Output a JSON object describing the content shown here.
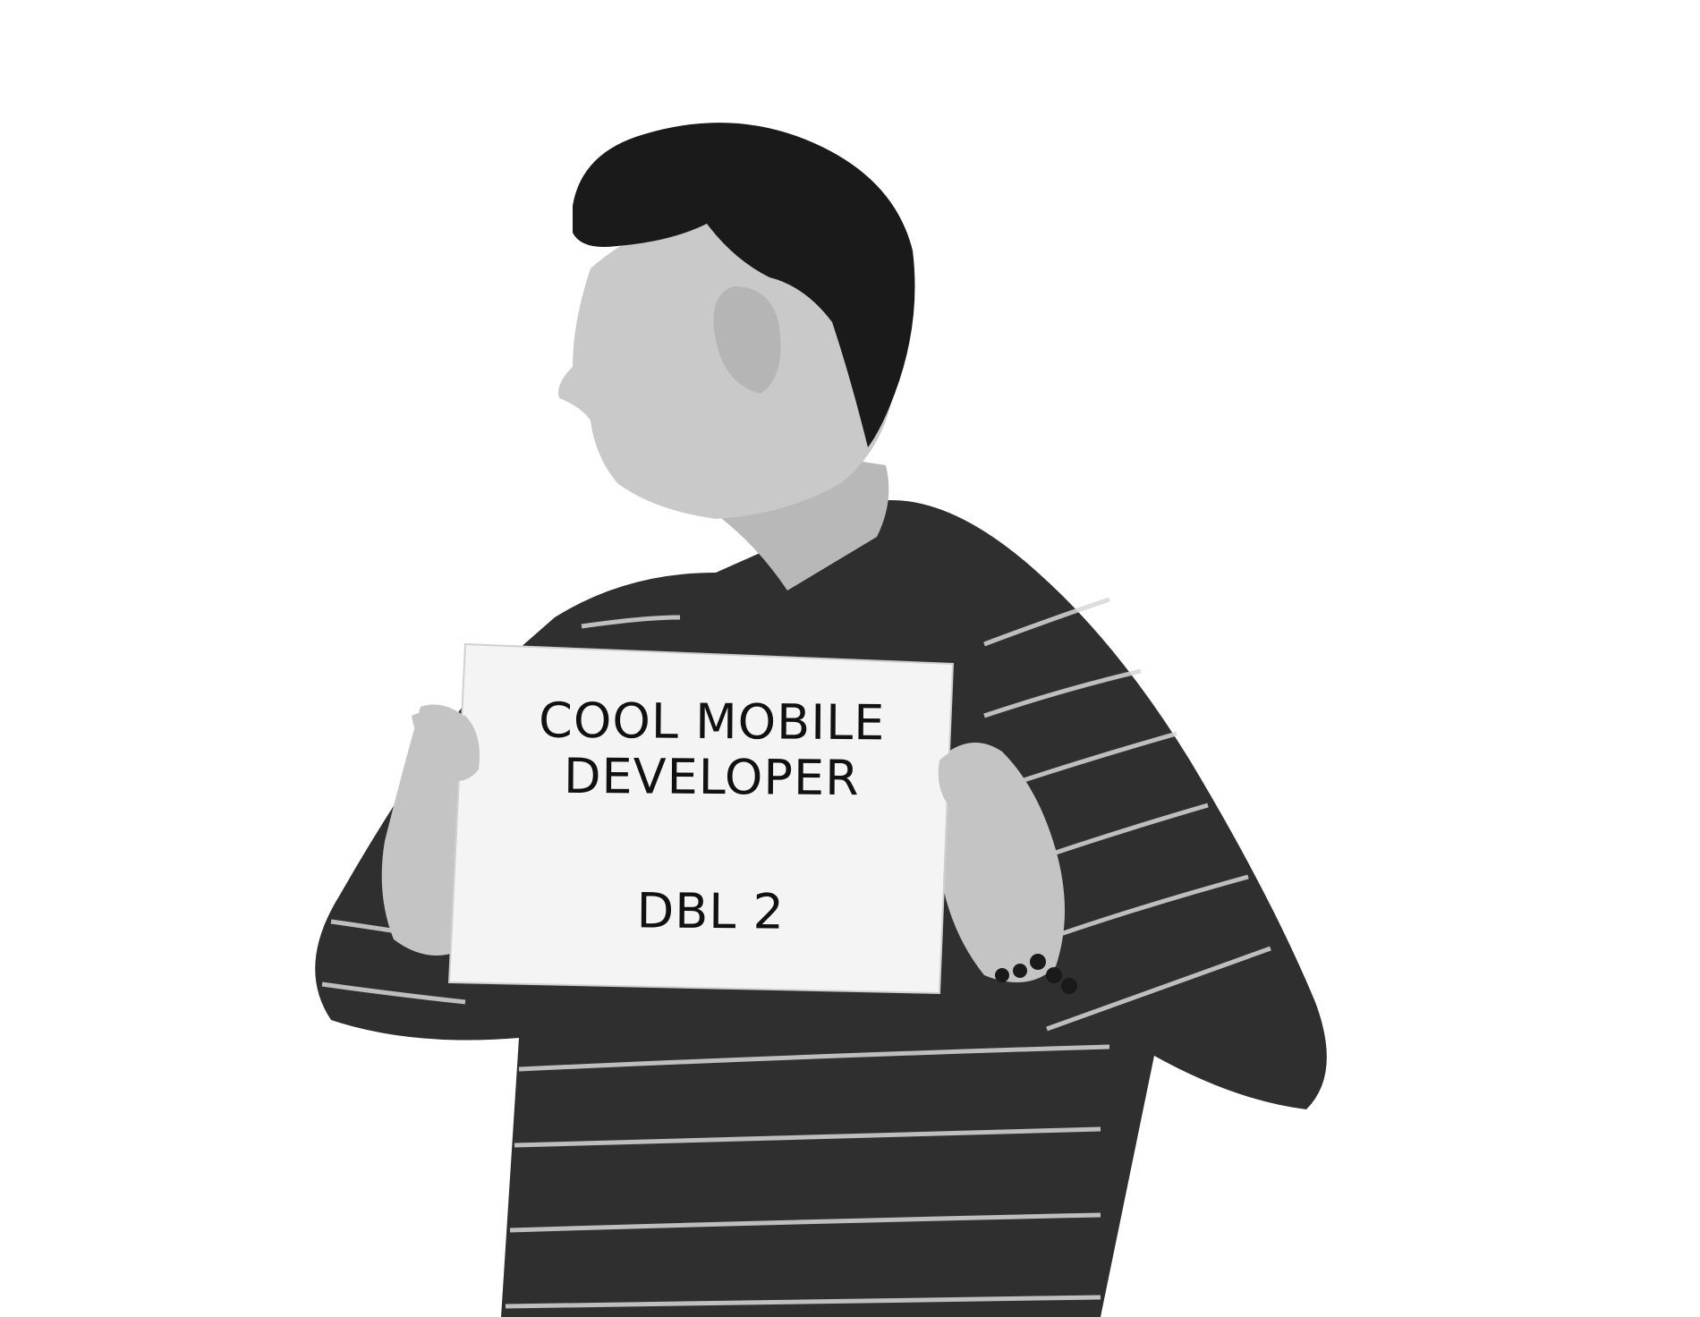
{
  "sign": {
    "line1": "COOL MOBILE",
    "line2": "DEVELOPER",
    "line3": "DBL 2"
  },
  "colors": {
    "background": "#ffffff",
    "sweater": "#2f2f2f",
    "stripe": "#d8d8d8",
    "hair": "#1a1a1a",
    "skin": "#c9c9c9",
    "sign": "#f4f4f4"
  }
}
